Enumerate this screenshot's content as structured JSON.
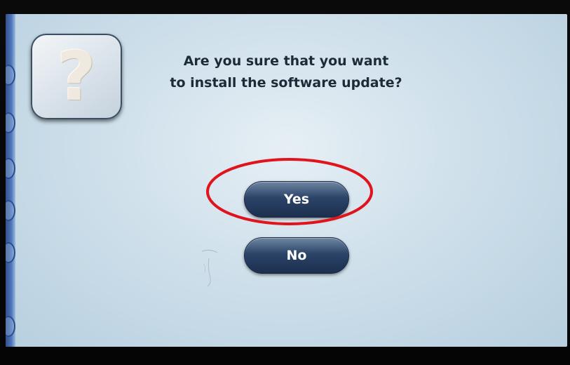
{
  "dialog": {
    "question_line1": "Are you sure that you want",
    "question_line2": "to install the software update?",
    "icon": "question-mark-icon"
  },
  "buttons": {
    "yes_label": "Yes",
    "no_label": "No"
  },
  "colors": {
    "screen_background": "#cfe0eb",
    "button_dark": "#1c2f4f",
    "highlight_ring": "#e0141c",
    "text": "#1d2a38"
  }
}
